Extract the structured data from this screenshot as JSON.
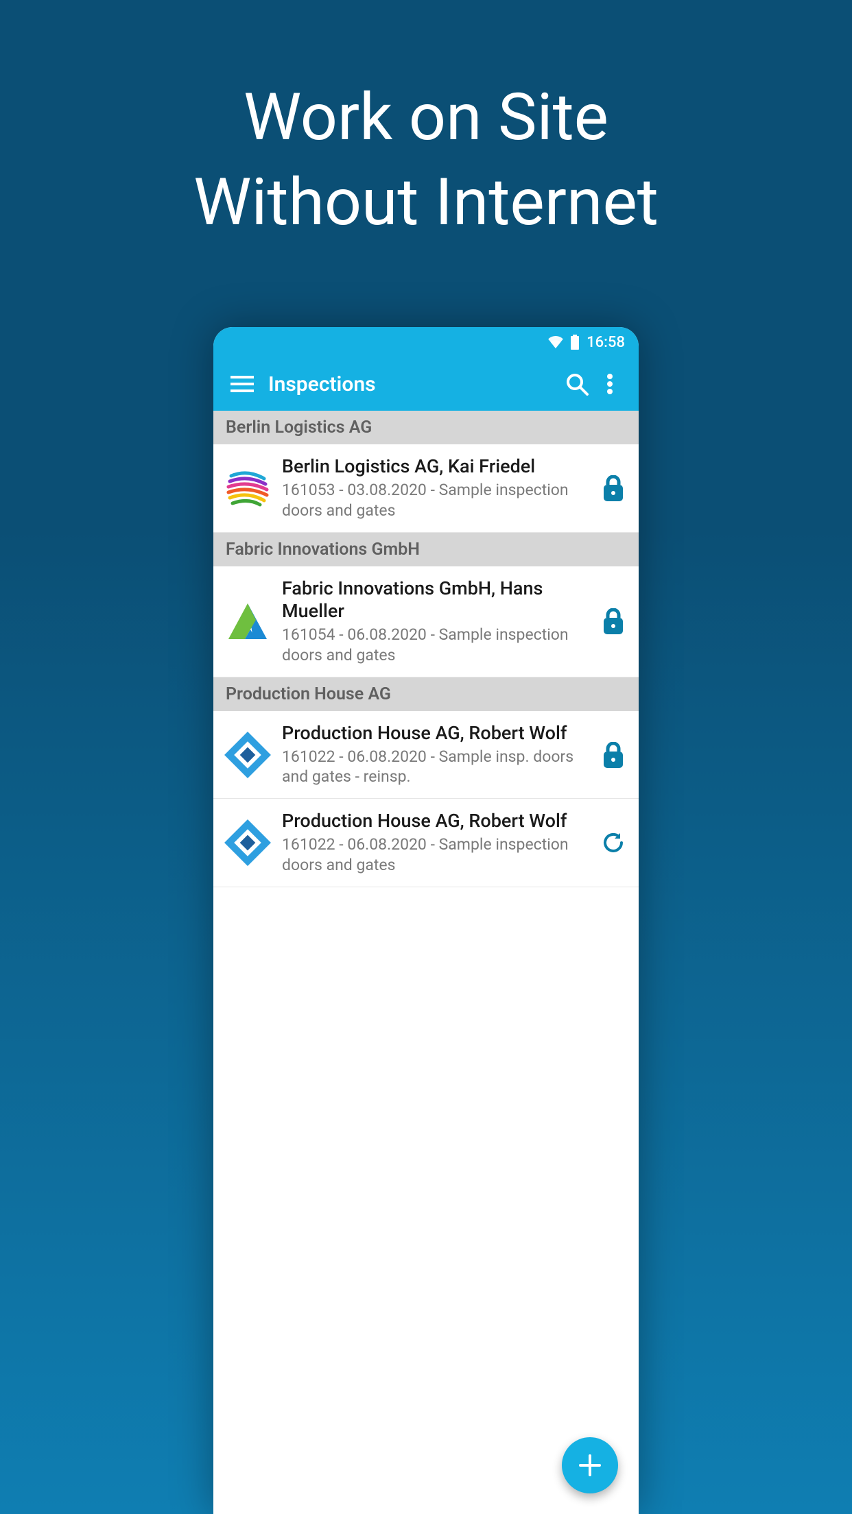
{
  "hero": {
    "line1": "Work on Site",
    "line2": "Without Internet"
  },
  "status": {
    "time": "16:58"
  },
  "appbar": {
    "title": "Inspections"
  },
  "groups": [
    {
      "header": "Berlin Logistics AG",
      "items": [
        {
          "title": "Berlin Logistics AG, Kai Friedel",
          "subtitle": "161053 - 03.08.2020 - Sample inspection doors and gates",
          "logo": "rainbow-swirl",
          "status_icon": "lock"
        }
      ]
    },
    {
      "header": "Fabric Innovations GmbH",
      "items": [
        {
          "title": "Fabric Innovations GmbH, Hans Mueller",
          "subtitle": "161054 - 06.08.2020 - Sample inspection doors and gates",
          "logo": "triangle-green-blue",
          "status_icon": "lock"
        }
      ]
    },
    {
      "header": "Production House AG",
      "items": [
        {
          "title": "Production House AG, Robert Wolf",
          "subtitle": "161022 - 06.08.2020 - Sample insp. doors and gates - reinsp.",
          "logo": "diamond-blue",
          "status_icon": "lock"
        },
        {
          "title": "Production House AG, Robert Wolf",
          "subtitle": "161022 - 06.08.2020 - Sample inspection doors and gates",
          "logo": "diamond-blue",
          "status_icon": "refresh"
        }
      ]
    }
  ],
  "colors": {
    "accent": "#15b1e3",
    "lock": "#0b7fa9"
  }
}
